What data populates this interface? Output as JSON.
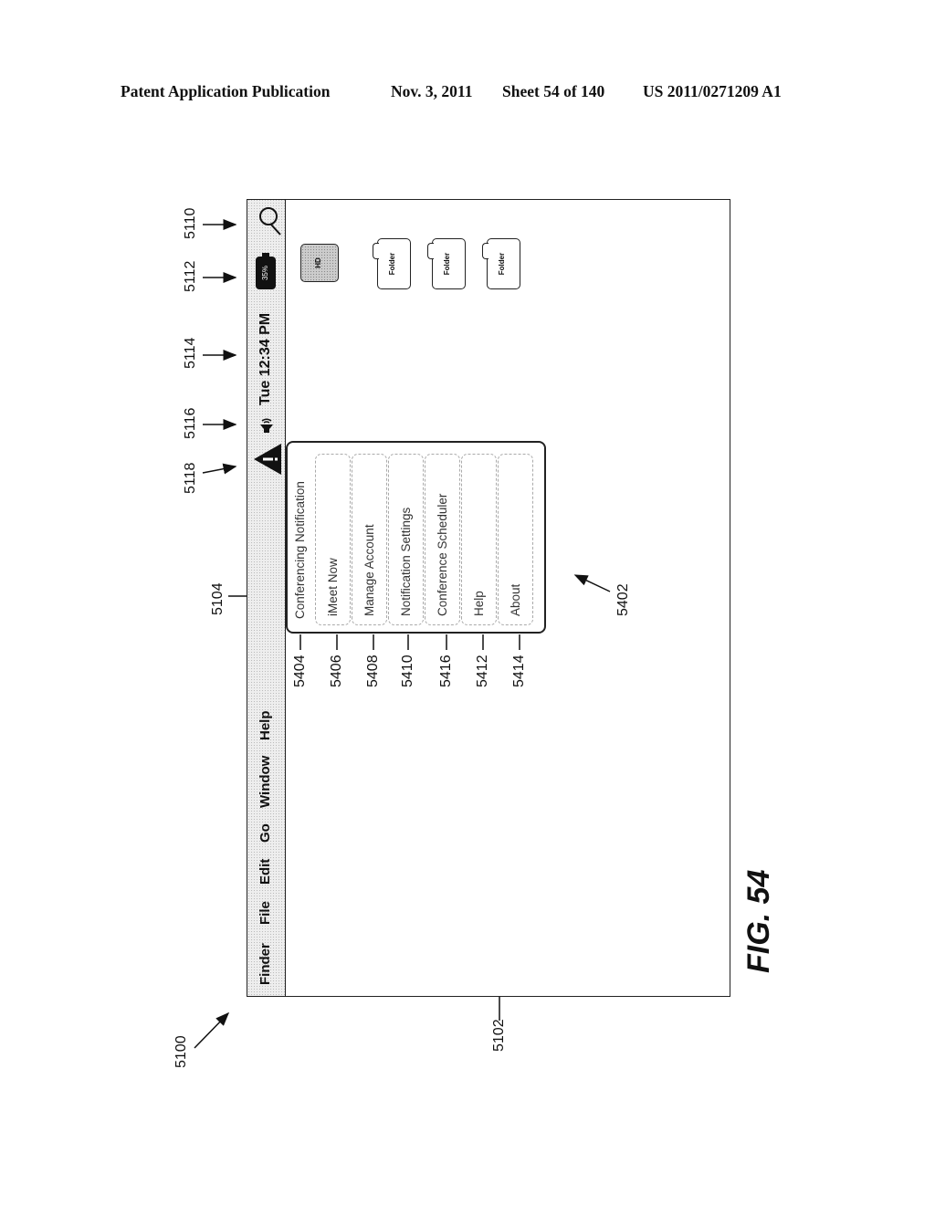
{
  "header": {
    "publication": "Patent Application Publication",
    "date": "Nov. 3, 2011",
    "sheet": "Sheet 54 of 140",
    "patent_number": "US 2011/0271209 A1"
  },
  "figure": {
    "label": "FIG. 54"
  },
  "reference_labels": {
    "system": "5100",
    "window": "5102",
    "menubar": "5104",
    "search": "5110",
    "battery": "5112",
    "clock": "5114",
    "volume": "5116",
    "notification": "5118",
    "popup_menu": "5402",
    "items": [
      "5404",
      "5406",
      "5408",
      "5410",
      "5416",
      "5412",
      "5414"
    ]
  },
  "menubar": {
    "items": [
      "Finder",
      "File",
      "Edit",
      "Go",
      "Window",
      "Help"
    ],
    "clock": "Tue 12:34 PM",
    "battery": "35%",
    "icons": [
      "warning-icon",
      "speaker-icon",
      "battery-icon",
      "search-icon"
    ]
  },
  "popup": {
    "title": "Conferencing Notification",
    "items": [
      "iMeet Now",
      "Manage Account",
      "Notification Settings",
      "Conference Scheduler",
      "Help",
      "About"
    ]
  },
  "desktop": {
    "hd_label": "HD",
    "folders": [
      "Folder",
      "Folder",
      "Folder"
    ]
  }
}
